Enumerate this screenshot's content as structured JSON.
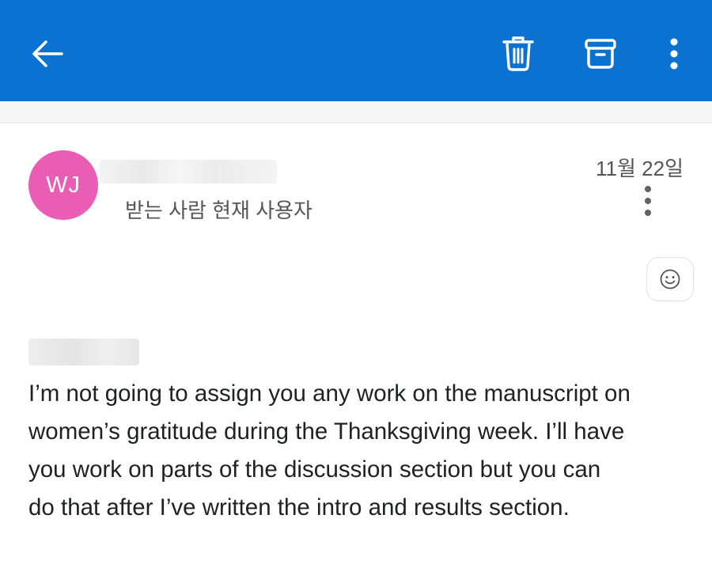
{
  "app_bar": {
    "background": "#0b72d1",
    "icons": [
      "back-arrow-icon",
      "trash-icon",
      "archive-icon",
      "more-vert-icon"
    ]
  },
  "message": {
    "avatar_initials": "WJ",
    "avatar_color": "#ea5db4",
    "recipient_line": "받는 사람 현재 사용자",
    "date": "11월 22일",
    "body_lines": [
      "I’m not going to assign you any work on the manuscript on",
      "women’s gratitude during the Thanksgiving week. I’ll have",
      "you work on parts of the discussion section but you can",
      "do that after I’ve written the intro and results section."
    ]
  }
}
